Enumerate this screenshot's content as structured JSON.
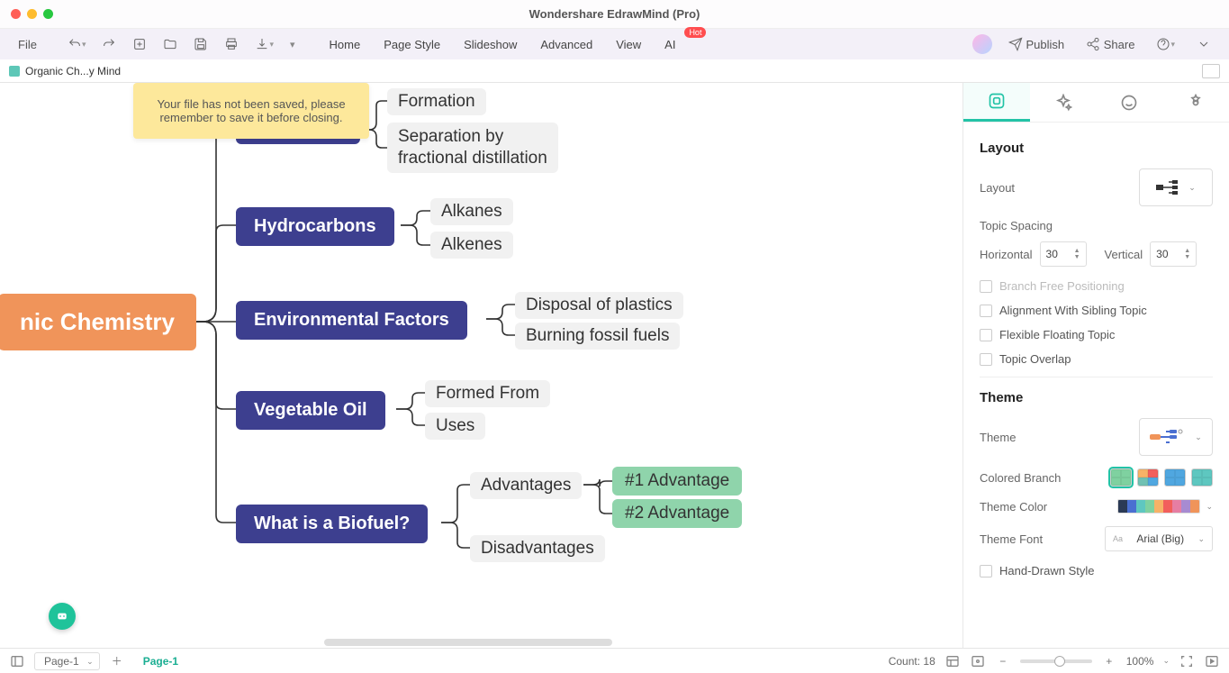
{
  "titlebar": {
    "title": "Wondershare EdrawMind (Pro)"
  },
  "toolbar": {
    "file": "File",
    "menus": [
      "Home",
      "Page Style",
      "Slideshow",
      "Advanced",
      "View",
      "AI"
    ],
    "hot": "Hot",
    "publish": "Publish",
    "share": "Share"
  },
  "doctab": {
    "name": "Organic Ch...y Mind"
  },
  "tooltip": {
    "text": "Your file has not been saved, please remember to save it before closing."
  },
  "mindmap": {
    "root": "nic Chemistry",
    "branches": [
      {
        "label": "",
        "leaves": [
          "Formation",
          "Separation by\nfractional distillation"
        ]
      },
      {
        "label": "Hydrocarbons",
        "leaves": [
          "Alkanes",
          "Alkenes"
        ]
      },
      {
        "label": "Environmental Factors",
        "leaves": [
          "Disposal of plastics",
          "Burning fossil fuels"
        ]
      },
      {
        "label": "Vegetable Oil",
        "leaves": [
          "Formed From",
          "Uses"
        ]
      },
      {
        "label": "What is a Biofuel?",
        "leaves": [
          "Advantages",
          "Disadvantages"
        ],
        "subleaves": [
          "#1 Advantage",
          "#2 Advantage"
        ]
      }
    ]
  },
  "sidepanel": {
    "layout_heading": "Layout",
    "layout_label": "Layout",
    "spacing_heading": "Topic Spacing",
    "horizontal": "Horizontal",
    "horizontal_val": "30",
    "vertical": "Vertical",
    "vertical_val": "30",
    "branch_free": "Branch Free Positioning",
    "align_sibling": "Alignment With Sibling Topic",
    "flex_float": "Flexible Floating Topic",
    "topic_overlap": "Topic Overlap",
    "theme_heading": "Theme",
    "theme_label": "Theme",
    "colored_branch": "Colored Branch",
    "theme_color": "Theme Color",
    "theme_font": "Theme Font",
    "theme_font_val": "Arial (Big)",
    "handdrawn": "Hand-Drawn Style"
  },
  "bottombar": {
    "page_sel": "Page-1",
    "page_tab": "Page-1",
    "count": "Count: 18",
    "zoom": "100%"
  }
}
